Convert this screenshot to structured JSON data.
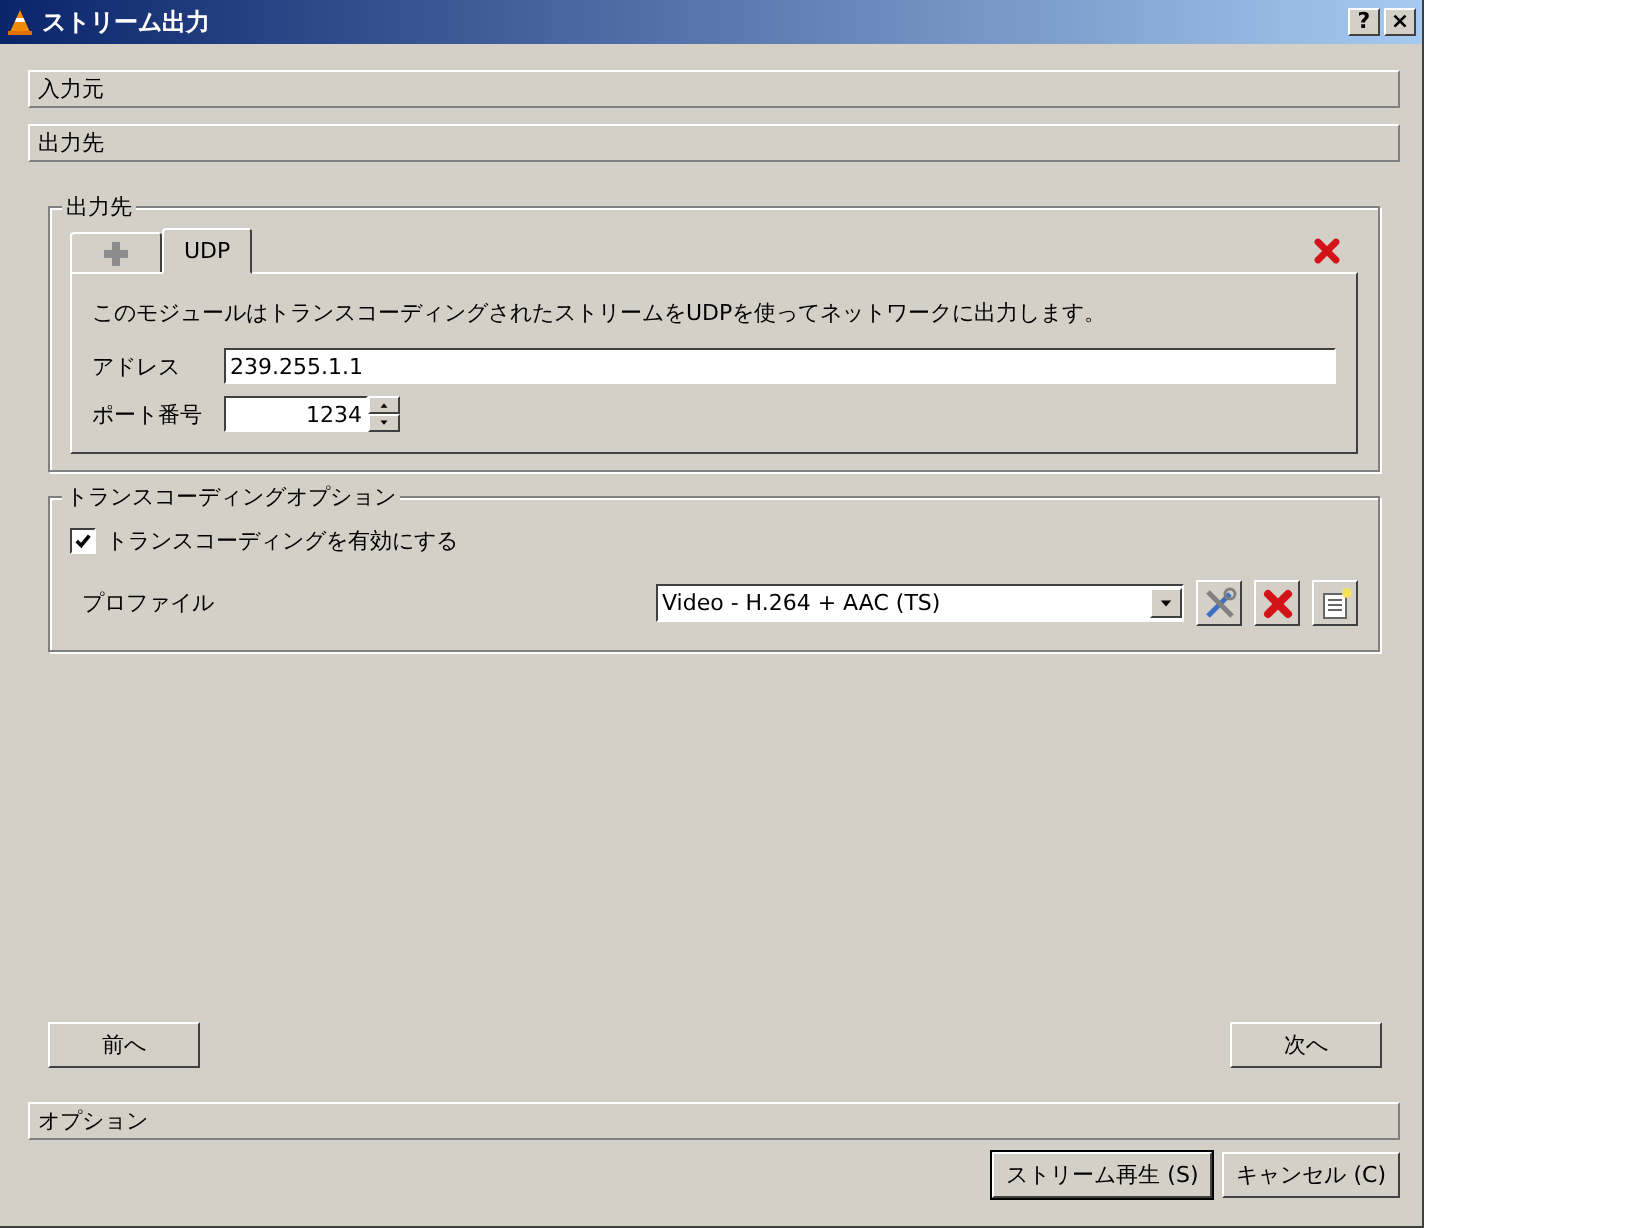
{
  "window": {
    "title": "ストリーム出力",
    "title_buttons": [
      "?",
      "×"
    ]
  },
  "sections": [
    {
      "label": "入力元"
    },
    {
      "label": "出力先"
    }
  ],
  "destination": {
    "title": "出力先",
    "tabs": [
      {
        "kind": "add",
        "selected": false
      },
      {
        "kind": "label",
        "label": "UDP",
        "selected": true
      }
    ],
    "description": "このモジュールはトランスコーディングされたストリームをUDPを使ってネットワークに出力します。",
    "address": {
      "label": "アドレス",
      "value": "239.255.1.1"
    },
    "port": {
      "label": "ポート番号",
      "value": "1234"
    }
  },
  "transcoding": {
    "title": "トランスコーディングオプション",
    "enable": {
      "label": "トランスコーディングを有効にする",
      "checked": true
    },
    "profile": {
      "label": "プロファイル",
      "value": "Video - H.264 + AAC (TS)"
    }
  },
  "nav_buttons": {
    "back": "前へ",
    "next": "次へ"
  },
  "options_bar": {
    "label": "オプション"
  },
  "buttons": [
    {
      "label": "ストリーム再生 (S)",
      "default": true
    },
    {
      "label": "キャンセル (C)",
      "default": false
    }
  ]
}
